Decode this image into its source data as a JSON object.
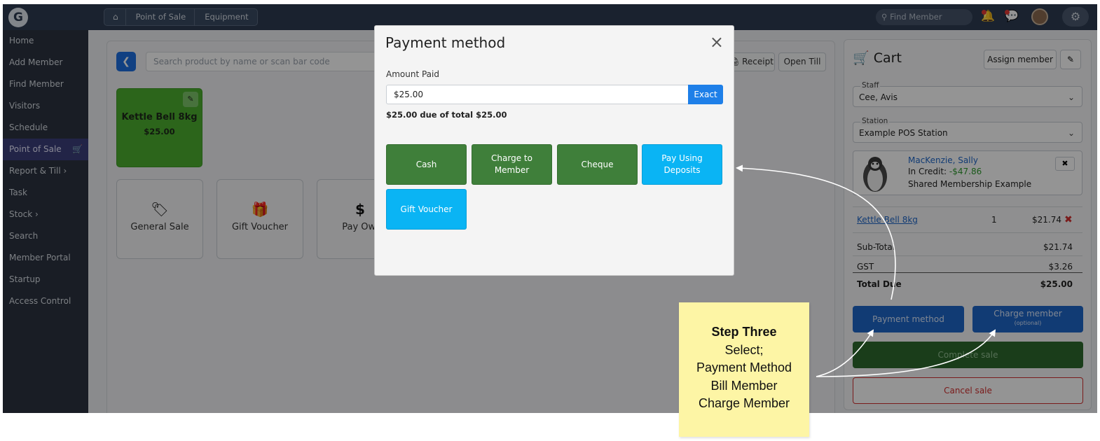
{
  "topbar": {
    "logo": "G",
    "breadcrumbs": [
      "Point of Sale",
      "Equipment"
    ],
    "find_member_placeholder": "Find Member"
  },
  "sidebar": {
    "items": [
      {
        "label": "Home"
      },
      {
        "label": "Add Member"
      },
      {
        "label": "Find Member"
      },
      {
        "label": "Visitors"
      },
      {
        "label": "Schedule"
      },
      {
        "label": "Point of Sale",
        "active": true
      },
      {
        "label": "Report & Till ›"
      },
      {
        "label": "Task"
      },
      {
        "label": "Stock ›"
      },
      {
        "label": "Search"
      },
      {
        "label": "Member Portal"
      },
      {
        "label": "Startup"
      },
      {
        "label": "Access Control"
      }
    ]
  },
  "main": {
    "search_placeholder": "Search product by name or scan bar code",
    "receipt_label": "Receipt",
    "open_till_label": "Open Till",
    "product": {
      "name": "Kettle Bell 8kg",
      "price": "$25.00",
      "color": "#4caf2f"
    },
    "quick_tiles": [
      {
        "label": "General Sale",
        "icon": "tags-icon"
      },
      {
        "label": "Gift Voucher",
        "icon": "gift-icon"
      },
      {
        "label": "Pay Owi",
        "icon": "dollar-icon"
      }
    ]
  },
  "cart": {
    "title": "Cart",
    "assign_label": "Assign member",
    "staff_legend": "Staff",
    "staff_value": "Cee, Avis",
    "station_legend": "Station",
    "station_value": "Example POS Station",
    "member": {
      "name": "MacKenzie, Sally",
      "credit_label": "In Credit:",
      "credit_value": "-$47.86",
      "membership": "Shared Membership Example"
    },
    "line_item": {
      "name": "Kettle Bell 8kg",
      "qty": "1",
      "price": "$21.74"
    },
    "subtotal_label": "Sub-Total",
    "subtotal_value": "$21.74",
    "gst_label": "GST",
    "gst_value": "$3.26",
    "total_label": "Total Due",
    "total_value": "$25.00",
    "payment_method_label": "Payment method",
    "charge_member_label": "Charge member",
    "charge_member_sub": "(optional)",
    "complete_label": "Complete sale",
    "cancel_label": "Cancel sale"
  },
  "modal": {
    "title": "Payment method",
    "amount_label": "Amount Paid",
    "amount_value": "$25.00",
    "exact_label": "Exact",
    "due_text": "$25.00 due of total $25.00",
    "options": [
      {
        "label": "Cash",
        "color": "#3f7f3a"
      },
      {
        "label": "Charge to Member",
        "color": "#3f7f3a"
      },
      {
        "label": "Cheque",
        "color": "#3f7f3a"
      },
      {
        "label": "Pay Using Deposits",
        "color": "#0ab4f4"
      },
      {
        "label": "Gift Voucher",
        "color": "#0ab4f4"
      }
    ]
  },
  "annotation": {
    "title": "Step Three",
    "lines": [
      "Select;",
      "Payment Method",
      "Bill Member",
      "Charge Member"
    ],
    "color": "#fdf5a5"
  }
}
